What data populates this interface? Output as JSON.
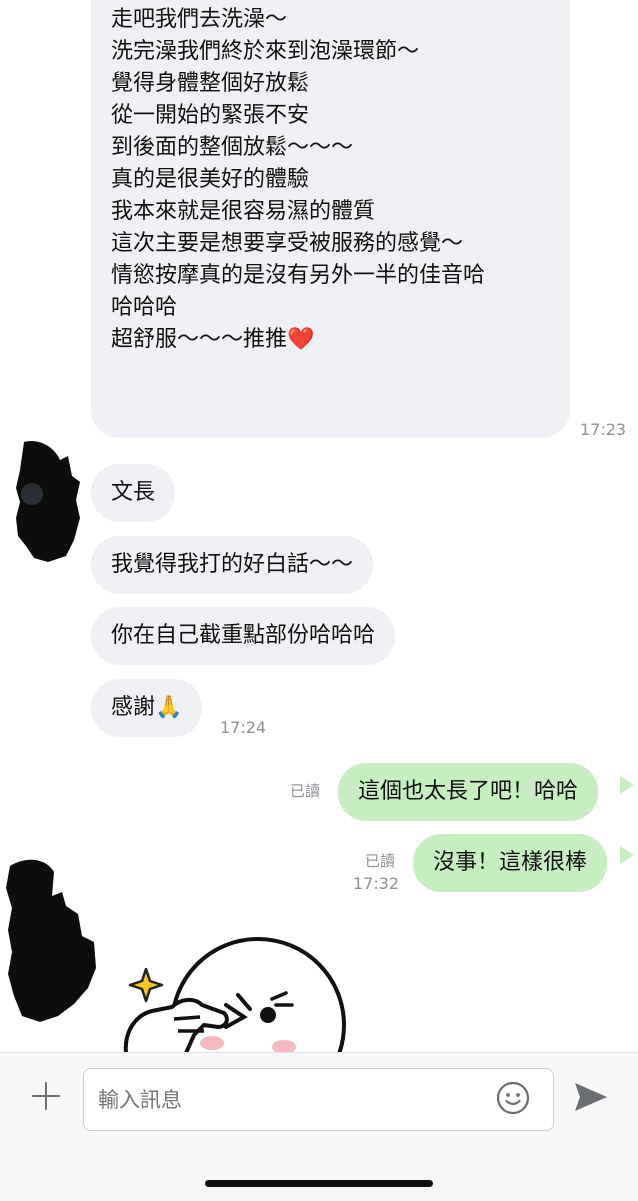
{
  "messages": {
    "long_text": "走吧我們去洗澡～\n洗完澡我們終於來到泡澡環節～\n覺得身體整個好放鬆\n從一開始的緊張不安\n到後面的整個放鬆～～～\n真的是很美好的體驗\n我本來就是很容易濕的體質\n這次主要是想要享受被服務的感覺～\n情慾按摩真的是沒有另外一半的佳音哈\n哈哈哈\n超舒服～～～推推❤️",
    "long_time": "17:23",
    "in1": "文長",
    "in2": "我覺得我打的好白話～～",
    "in3": "你在自己截重點部份哈哈哈",
    "in4": "感謝🙏",
    "in4_time": "17:24",
    "out1": "這個也太長了吧！哈哈",
    "out1_read": "已讀",
    "out2": "沒事！這樣很棒",
    "out2_read": "已讀",
    "out2_time": "17:32"
  },
  "input": {
    "placeholder": "輸入訊息"
  },
  "icons": {
    "add": "plus-icon",
    "emoji": "smiley-icon",
    "send": "send-arrow-icon",
    "sticker": "moon-sticker-icon"
  },
  "colors": {
    "incoming_bubble": "#eef0f3",
    "outgoing_bubble": "#c6eec0",
    "meta_text": "#8c9096"
  }
}
